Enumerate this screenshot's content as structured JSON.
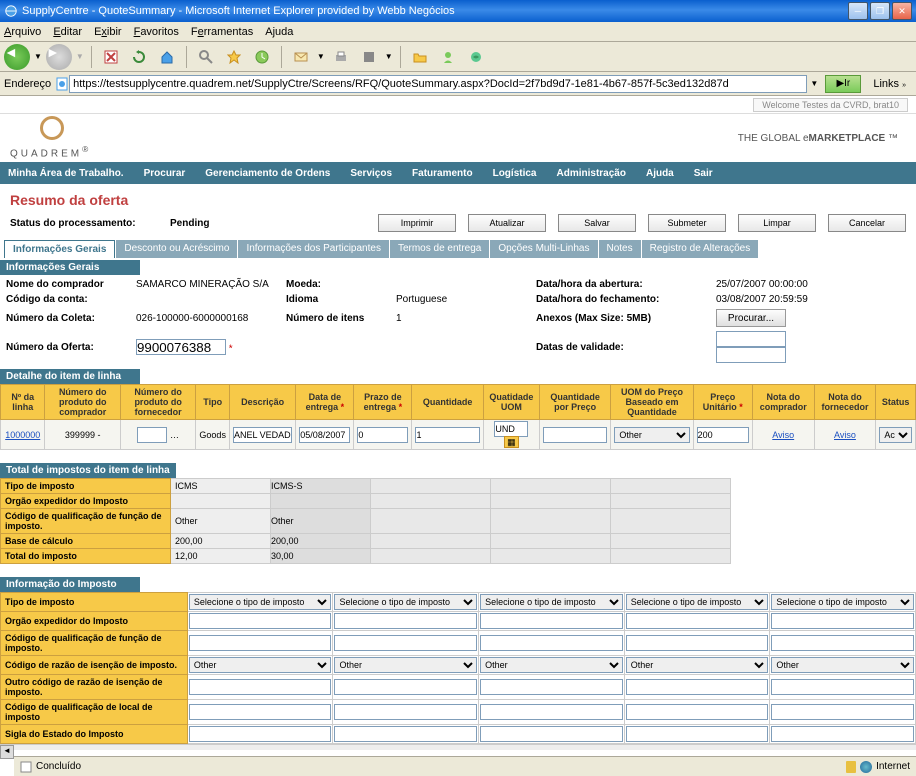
{
  "window": {
    "title": "SupplyCentre - QuoteSummary - Microsoft Internet Explorer provided by Webb Negócios"
  },
  "menubar": [
    "Arquivo",
    "Editar",
    "Exibir",
    "Favoritos",
    "Ferramentas",
    "Ajuda"
  ],
  "address": {
    "label": "Endereço",
    "url": "https://testsupplycentre.quadrem.net/SupplyCtre/Screens/RFQ/QuoteSummary.aspx?DocId=2f7bd9d7-1e81-4b67-857f-5c3ed132d87d",
    "go": "Ir",
    "links": "Links"
  },
  "welcome": "Welcome Testes da CVRD, brat10",
  "brand": {
    "name": "QUADREM",
    "tagline_pre": "THE GLOBAL e",
    "tagline_bold": "MARKETPLACE",
    "tm": "™"
  },
  "nav": [
    "Minha Área de Trabalho.",
    "Procurar",
    "Gerenciamento de Ordens",
    "Serviços",
    "Faturamento",
    "Logística",
    "Administração",
    "Ajuda",
    "Sair"
  ],
  "page": {
    "title": "Resumo da oferta",
    "status_label": "Status do processamento:",
    "status_value": "Pending"
  },
  "actions": {
    "print": "Imprimir",
    "update": "Atualizar",
    "save": "Salvar",
    "submit": "Submeter",
    "clear": "Limpar",
    "cancel": "Cancelar"
  },
  "tabs": [
    "Informações Gerais",
    "Desconto ou Acréscimo",
    "Informações dos Participantes",
    "Termos de entrega",
    "Opções Multi-Linhas",
    "Notes",
    "Registro de Alterações"
  ],
  "sections": {
    "general": "Informações Gerais",
    "line_detail": "Detalhe do item de linha",
    "tax_total": "Total de impostos do item de linha",
    "tax_info": "Informação do Imposto"
  },
  "general": {
    "buyer_name_lbl": "Nome do comprador",
    "buyer_name": "SAMARCO MINERAÇÃO S/A",
    "currency_lbl": "Moeda:",
    "currency": "",
    "open_dt_lbl": "Data/hora da abertura:",
    "open_dt": "25/07/2007 00:00:00",
    "acct_lbl": "Código da conta:",
    "acct": "",
    "lang_lbl": "Idioma",
    "lang": "Portuguese",
    "close_dt_lbl": "Data/hora do fechamento:",
    "close_dt": "03/08/2007 20:59:59",
    "collect_lbl": "Número da Coleta:",
    "collect": "026-100000-6000000168",
    "items_lbl": "Número de itens",
    "items": "1",
    "attach_lbl": "Anexos   (Max Size: 5MB)",
    "browse": "Procurar...",
    "quote_lbl": "Número da Oferta:",
    "quote": "9900076388",
    "valid_lbl": "Datas de validade:"
  },
  "line_headers": {
    "line_no": "Nº da linha",
    "buyer_prod": "Número do produto do comprador",
    "supp_prod": "Número do produto do fornecedor",
    "type": "Tipo",
    "desc": "Descrição",
    "deliv_date": "Data de entrega",
    "deliv_term": "Prazo de entrega",
    "qty": "Quantidade",
    "qty_uom": "Quatidade UOM",
    "price_per_qty": "Quantidade por Preço",
    "price_uom": "UOM do Preço Baseado em Quantidade",
    "unit_price": "Preço Unitário",
    "buyer_note": "Nota do comprador",
    "supp_note": "Nota do fornecedor",
    "status": "Status"
  },
  "line_row": {
    "line_no": "1000000",
    "buyer_prod": "399999 -",
    "supp_prod": "",
    "type": "Goods",
    "desc": "ANEL VEDADOR WOI",
    "deliv_date": "05/08/2007",
    "deliv_term": "0",
    "qty": "1",
    "qty_uom": "UND",
    "price_per_qty": "",
    "price_uom": "Other",
    "unit_price": "200",
    "buyer_note": "Aviso",
    "supp_note": "Aviso",
    "status": "Aceitar"
  },
  "tax_total": {
    "rows": [
      {
        "label": "Tipo de imposto",
        "v1": "ICMS",
        "v2": "ICMS-S"
      },
      {
        "label": "Orgão expedidor do Imposto",
        "v1": "",
        "v2": ""
      },
      {
        "label": "Código de qualificação de função de imposto.",
        "v1": "Other",
        "v2": "Other"
      },
      {
        "label": "Base de cálculo",
        "v1": "200,00",
        "v2": "200,00"
      },
      {
        "label": "Total do imposto",
        "v1": "12,00",
        "v2": "30,00"
      }
    ]
  },
  "tax_info": {
    "select_placeholder": "Selecione o tipo de imposto",
    "other": "Other",
    "rows": [
      "Tipo de imposto",
      "Orgão expedidor do Imposto",
      "Código de qualificação de função de imposto.",
      "Código de razão de isenção de imposto.",
      "Outro código de razão de isenção de imposto.",
      "Código de qualificação de local de imposto",
      "Sigla do Estado do Imposto"
    ]
  },
  "statusbar": {
    "done": "Concluído",
    "zone": "Internet"
  }
}
